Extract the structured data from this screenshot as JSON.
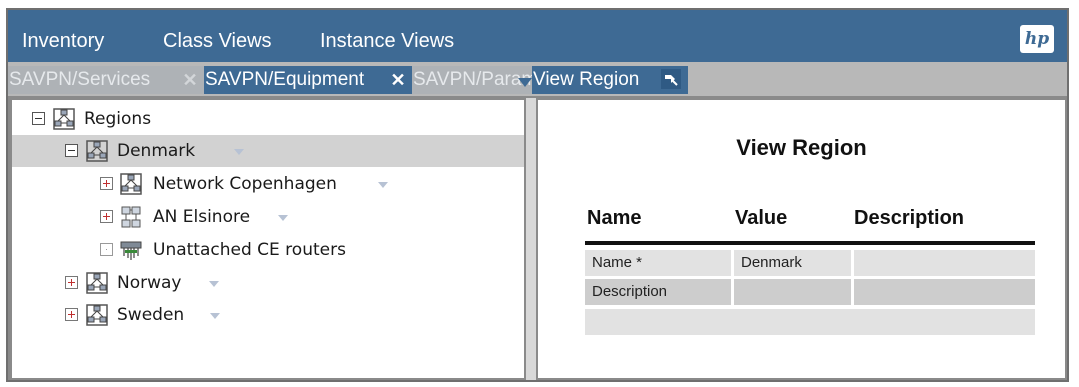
{
  "menubar": {
    "items": [
      "Inventory",
      "Class Views",
      "Instance Views"
    ],
    "logo": "hp",
    "bg_color": "#3e6a94"
  },
  "tabs": [
    {
      "label": "SAVPN/Services",
      "active": false
    },
    {
      "label": "SAVPN/Equipment",
      "active": true
    },
    {
      "label": "SAVPN/Parameters",
      "active": false
    },
    {
      "label": "View Region",
      "active": true
    }
  ],
  "tree": {
    "root": {
      "label": "Regions",
      "icon": "region-icon"
    },
    "nodes": [
      {
        "label": "Denmark",
        "icon": "region-icon",
        "selected": true
      },
      {
        "label": "Network Copenhagen",
        "icon": "region-icon"
      },
      {
        "label": "AN Elsinore",
        "icon": "network-icon"
      },
      {
        "label": "Unattached CE routers",
        "icon": "router-icon"
      },
      {
        "label": "Norway",
        "icon": "region-icon"
      },
      {
        "label": "Sweden",
        "icon": "region-icon"
      }
    ]
  },
  "detail": {
    "title": "View Region",
    "columns": [
      "Name",
      "Value",
      "Description"
    ],
    "rows": [
      {
        "name": "Name *",
        "value": "Denmark",
        "description": ""
      },
      {
        "name": "Description",
        "value": "",
        "description": ""
      },
      {
        "name": "",
        "value": "",
        "description": ""
      }
    ]
  }
}
